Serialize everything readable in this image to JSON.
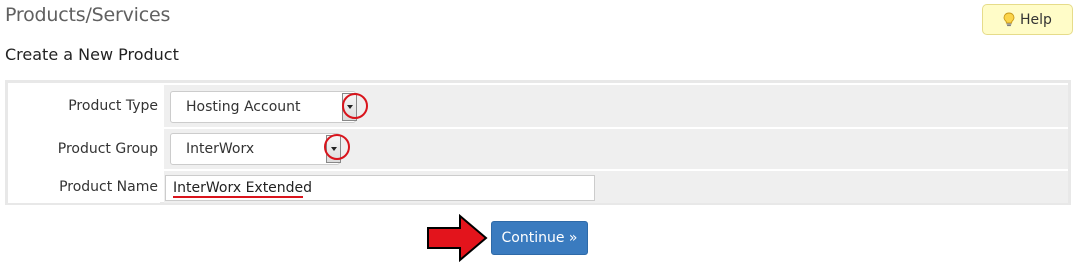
{
  "header": {
    "title": "Products/Services",
    "help_label": "Help"
  },
  "section": {
    "title": "Create a New Product"
  },
  "form": {
    "product_type": {
      "label": "Product Type",
      "selected": "Hosting Account"
    },
    "product_group": {
      "label": "Product Group",
      "selected": "InterWorx"
    },
    "product_name": {
      "label": "Product Name",
      "value": "InterWorx Extended"
    }
  },
  "actions": {
    "continue_label": "Continue »"
  },
  "annotations": {
    "highlight_color": "#d9141c"
  },
  "icons": {
    "help": "lightbulb-icon",
    "dropdown": "chevron-down-icon",
    "pointer": "arrow-right-icon"
  }
}
